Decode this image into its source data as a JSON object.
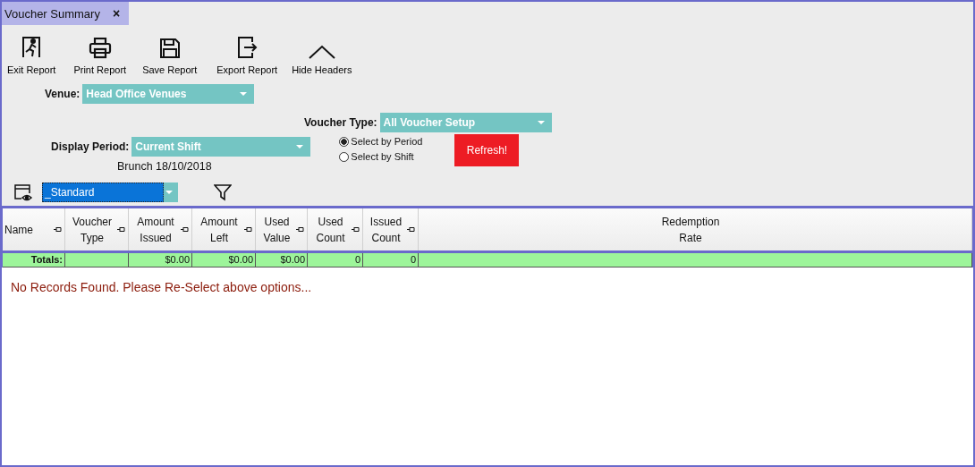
{
  "tab": {
    "title": "Voucher Summary",
    "close": "×"
  },
  "toolbar": [
    {
      "kind": "exit",
      "label": "Exit Report"
    },
    {
      "kind": "print",
      "label": "Print Report"
    },
    {
      "kind": "save",
      "label": "Save Report"
    },
    {
      "kind": "export",
      "label": "Export Report"
    },
    {
      "kind": "hide",
      "label": "Hide Headers"
    }
  ],
  "venue": {
    "label": "Venue:",
    "value": "Head Office Venues"
  },
  "voucher_type": {
    "label": "Voucher Type:",
    "value": "All Voucher Setup"
  },
  "display_period": {
    "label": "Display Period:",
    "value": "Current Shift",
    "caption": "Brunch 18/10/2018"
  },
  "selection_mode": [
    {
      "label": "Select by Period",
      "selected": true
    },
    {
      "label": "Select by Shift",
      "selected": false
    }
  ],
  "refresh_button": "Refresh!",
  "layout": {
    "value": "_Standard"
  },
  "table": {
    "columns": [
      {
        "label": "Name",
        "pin": true,
        "total": "Totals:"
      },
      {
        "label": "Voucher Type",
        "pin": true
      },
      {
        "label": "Amount Issued",
        "pin": true,
        "total": "$0.00"
      },
      {
        "label": "Amount Left",
        "pin": true,
        "total": "$0.00"
      },
      {
        "label": "Used Value",
        "pin": true,
        "total": "$0.00"
      },
      {
        "label": "Used Count",
        "pin": true,
        "total": "0"
      },
      {
        "label": "Issued Count",
        "pin": true,
        "total": "0"
      },
      {
        "label": "Redemption Rate",
        "pin": false
      }
    ],
    "message": "No Records Found. Please Re-Select above options..."
  }
}
